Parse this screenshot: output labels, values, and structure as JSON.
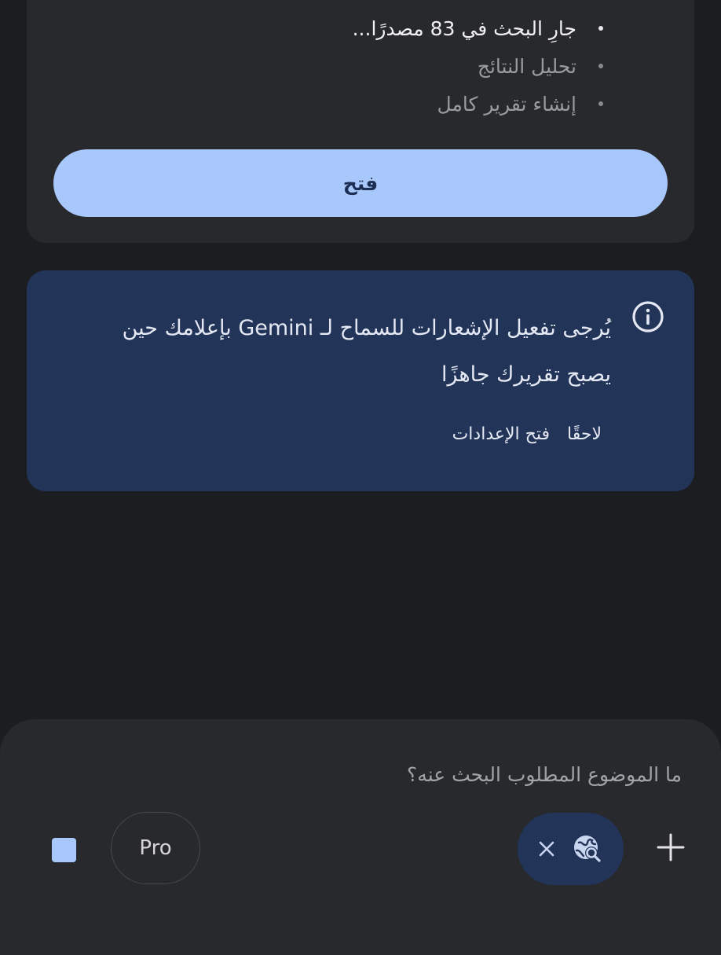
{
  "research": {
    "steps": [
      {
        "label": "جارِ البحث في 83 مصدرًا...",
        "state": "active"
      },
      {
        "label": "تحليل النتائج",
        "state": "pending"
      },
      {
        "label": "إنشاء تقرير كامل",
        "state": "pending"
      }
    ],
    "open_label": "فتح"
  },
  "notice": {
    "icon": "info-icon",
    "text": "يُرجى تفعيل الإشعارات للسماح لـ Gemini بإعلامك حين يصبح تقريرك جاهزًا",
    "later_label": "لاحقًا",
    "settings_label": "فتح الإعدادات"
  },
  "composer": {
    "placeholder": "ما الموضوع المطلوب البحث عنه؟",
    "model_label": "Pro",
    "tool_icon": "deep-research-globe-icon",
    "add_icon": "plus-icon",
    "stop_icon": "stop-icon"
  },
  "colors": {
    "background": "#1c1d20",
    "card": "#28292c",
    "accent": "#a8c7fa",
    "notice_bg": "#233459"
  }
}
